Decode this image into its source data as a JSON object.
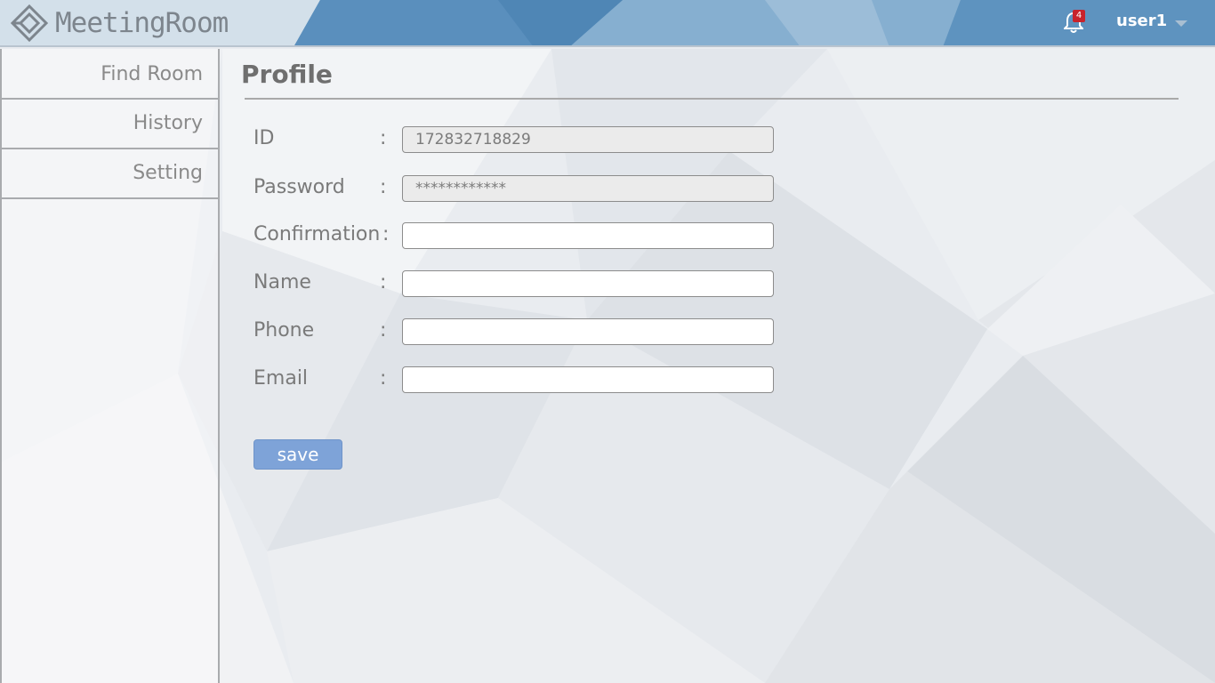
{
  "app": {
    "logo_text": "MeetingRoom",
    "notification_count": "4",
    "username": "user1"
  },
  "sidebar": {
    "items": [
      {
        "label": "Find Room"
      },
      {
        "label": "History"
      },
      {
        "label": "Setting"
      }
    ]
  },
  "main": {
    "title": "Profile",
    "fields": [
      {
        "label": "ID",
        "colon": ":",
        "value": "172832718829",
        "readonly": true
      },
      {
        "label": "Password",
        "colon": ":",
        "value": "************",
        "readonly": true
      },
      {
        "label": "Confirmation",
        "colon": ":",
        "value": "",
        "readonly": false
      },
      {
        "label": "Name",
        "colon": ":",
        "value": "",
        "readonly": false
      },
      {
        "label": "Phone",
        "colon": ":",
        "value": "",
        "readonly": false
      },
      {
        "label": "Email",
        "colon": ":",
        "value": "",
        "readonly": false
      }
    ],
    "save_label": "save"
  },
  "colors": {
    "header_blue": "#5b93c0",
    "save_button": "#7ea3d8",
    "badge_red": "#c8232c",
    "text_gray": "#7a7a7a"
  },
  "icons": {
    "logo": "diamond-logo-icon",
    "notifications": "bell-icon",
    "user_menu": "caret-down-icon"
  }
}
